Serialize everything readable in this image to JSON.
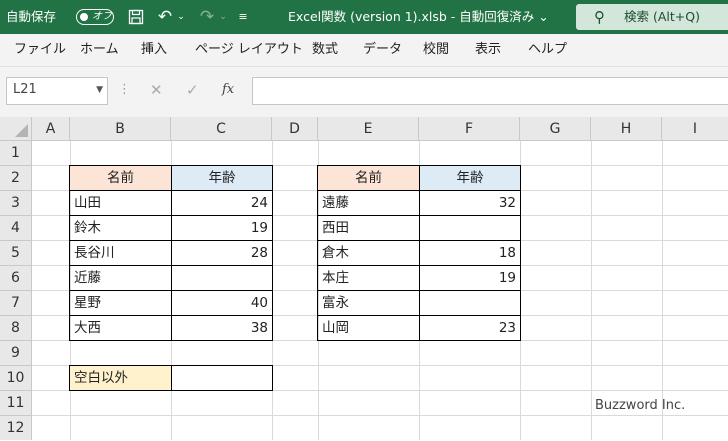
{
  "titlebar": {
    "autosave_label": "自動保存",
    "autosave_state": "オフ",
    "doc_title": "Excel関数 (version 1).xlsb  -  自動回復済み  ⌄",
    "search_label": "検索 (Alt+Q)",
    "accent_color": "#217346"
  },
  "menu": [
    "ファイル",
    "ホーム",
    "挿入",
    "ページ レイアウト",
    "数式",
    "データ",
    "校閲",
    "表示",
    "ヘルプ"
  ],
  "formula_bar": {
    "name_box": "L21",
    "fx_label": "fx",
    "formula": ""
  },
  "columns": [
    "A",
    "B",
    "C",
    "D",
    "E",
    "F",
    "G",
    "H",
    "I"
  ],
  "rows": [
    "1",
    "2",
    "3",
    "4",
    "5",
    "6",
    "7",
    "8",
    "9",
    "10",
    "11",
    "12"
  ],
  "table1": {
    "headers": [
      "名前",
      "年齢"
    ],
    "rows": [
      {
        "name": "山田",
        "age": "24"
      },
      {
        "name": "鈴木",
        "age": "19"
      },
      {
        "name": "長谷川",
        "age": "28"
      },
      {
        "name": "近藤",
        "age": ""
      },
      {
        "name": "星野",
        "age": "40"
      },
      {
        "name": "大西",
        "age": "38"
      }
    ]
  },
  "table2": {
    "headers": [
      "名前",
      "年齢"
    ],
    "rows": [
      {
        "name": "遠藤",
        "age": "32"
      },
      {
        "name": "西田",
        "age": ""
      },
      {
        "name": "倉木",
        "age": "18"
      },
      {
        "name": "本庄",
        "age": "19"
      },
      {
        "name": "富永",
        "age": ""
      },
      {
        "name": "山岡",
        "age": "23"
      }
    ]
  },
  "summary": {
    "label": "空白以外",
    "value": ""
  },
  "colors": {
    "name_header_bg": "#fce4d6",
    "age_header_bg": "#ddebf7",
    "summary_bg": "#fff2cc"
  },
  "watermark": "Buzzword Inc."
}
